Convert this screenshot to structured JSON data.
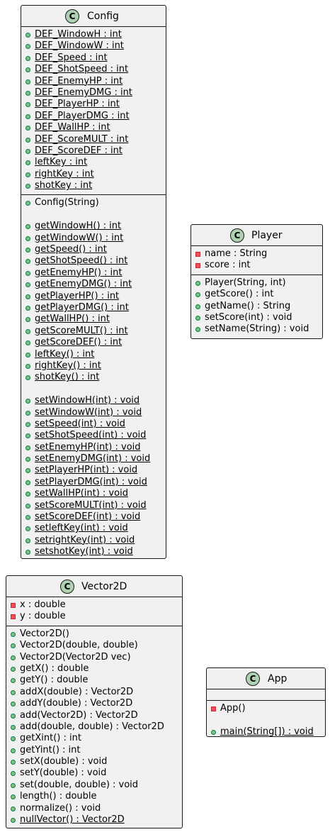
{
  "classes": {
    "config": {
      "name": "Config",
      "attributes": [
        {
          "text": "DEF_WindowH : int",
          "vis": "public",
          "static": true
        },
        {
          "text": "DEF_WindowW : int",
          "vis": "public",
          "static": true
        },
        {
          "text": "DEF_Speed : int",
          "vis": "public",
          "static": true
        },
        {
          "text": "DEF_ShotSpeed : int",
          "vis": "public",
          "static": true
        },
        {
          "text": "DEF_EnemyHP : int",
          "vis": "public",
          "static": true
        },
        {
          "text": "DEF_EnemyDMG : int",
          "vis": "public",
          "static": true
        },
        {
          "text": "DEF_PlayerHP : int",
          "vis": "public",
          "static": true
        },
        {
          "text": "DEF_PlayerDMG : int",
          "vis": "public",
          "static": true
        },
        {
          "text": "DEF_WallHP : int",
          "vis": "public",
          "static": true
        },
        {
          "text": "DEF_ScoreMULT : int",
          "vis": "public",
          "static": true
        },
        {
          "text": "DEF_ScoreDEF : int",
          "vis": "public",
          "static": true
        },
        {
          "text": "leftKey : int",
          "vis": "public",
          "static": true
        },
        {
          "text": "rightKey : int",
          "vis": "public",
          "static": true
        },
        {
          "text": "shotKey : int",
          "vis": "public",
          "static": true
        }
      ],
      "methods": [
        {
          "text": "Config(String)",
          "vis": "public",
          "static": false
        },
        {
          "gap": true
        },
        {
          "text": "getWindowH() : int",
          "vis": "public",
          "static": true
        },
        {
          "text": "getWindowW() : int",
          "vis": "public",
          "static": true
        },
        {
          "text": "getSpeed() : int",
          "vis": "public",
          "static": true
        },
        {
          "text": "getShotSpeed() : int",
          "vis": "public",
          "static": true
        },
        {
          "text": "getEnemyHP() : int",
          "vis": "public",
          "static": true
        },
        {
          "text": "getEnemyDMG() : int",
          "vis": "public",
          "static": true
        },
        {
          "text": "getPlayerHP() : int",
          "vis": "public",
          "static": true
        },
        {
          "text": "getPlayerDMG() : int",
          "vis": "public",
          "static": true
        },
        {
          "text": "getWallHP() : int",
          "vis": "public",
          "static": true
        },
        {
          "text": "getScoreMULT() : int",
          "vis": "public",
          "static": true
        },
        {
          "text": "getScoreDEF() : int",
          "vis": "public",
          "static": true
        },
        {
          "text": "leftKey() : int",
          "vis": "public",
          "static": true
        },
        {
          "text": "rightKey() : int",
          "vis": "public",
          "static": true
        },
        {
          "text": "shotKey() : int",
          "vis": "public",
          "static": true
        },
        {
          "gap": true
        },
        {
          "text": "setWindowH(int) : void",
          "vis": "public",
          "static": true
        },
        {
          "text": "setWindowW(int) : void",
          "vis": "public",
          "static": true
        },
        {
          "text": "setSpeed(int) : void",
          "vis": "public",
          "static": true
        },
        {
          "text": "setShotSpeed(int) : void",
          "vis": "public",
          "static": true
        },
        {
          "text": "setEnemyHP(int) : void",
          "vis": "public",
          "static": true
        },
        {
          "text": "setEnemyDMG(int) : void",
          "vis": "public",
          "static": true
        },
        {
          "text": "setPlayerHP(int) : void",
          "vis": "public",
          "static": true
        },
        {
          "text": "setPlayerDMG(int) : void",
          "vis": "public",
          "static": true
        },
        {
          "text": "setWallHP(int) : void",
          "vis": "public",
          "static": true
        },
        {
          "text": "setScoreMULT(int) : void",
          "vis": "public",
          "static": true
        },
        {
          "text": "setScoreDEF(int) : void",
          "vis": "public",
          "static": true
        },
        {
          "text": "setleftKey(int) : void",
          "vis": "public",
          "static": true
        },
        {
          "text": "setrightKey(int) : void",
          "vis": "public",
          "static": true
        },
        {
          "text": "setshotKey(int) : void",
          "vis": "public",
          "static": true
        }
      ]
    },
    "player": {
      "name": "Player",
      "attributes": [
        {
          "text": "name : String",
          "vis": "private",
          "static": false
        },
        {
          "text": "score : int",
          "vis": "private",
          "static": false
        }
      ],
      "methods": [
        {
          "text": "Player(String, int)",
          "vis": "public",
          "static": false
        },
        {
          "text": "getScore() : int",
          "vis": "public",
          "static": false
        },
        {
          "text": "getName() : String",
          "vis": "public",
          "static": false
        },
        {
          "text": "setScore(int) : void",
          "vis": "public",
          "static": false
        },
        {
          "text": "setName(String) : void",
          "vis": "public",
          "static": false
        }
      ]
    },
    "vector2d": {
      "name": "Vector2D",
      "attributes": [
        {
          "text": "x : double",
          "vis": "private",
          "static": false
        },
        {
          "text": "y : double",
          "vis": "private",
          "static": false
        }
      ],
      "methods": [
        {
          "text": "Vector2D()",
          "vis": "public",
          "static": false
        },
        {
          "text": "Vector2D(double, double)",
          "vis": "public",
          "static": false
        },
        {
          "text": "Vector2D(Vector2D vec)",
          "vis": "public",
          "static": false
        },
        {
          "text": "getX() : double",
          "vis": "public",
          "static": false
        },
        {
          "text": "getY() : double",
          "vis": "public",
          "static": false
        },
        {
          "text": "addX(double) : Vector2D",
          "vis": "public",
          "static": false
        },
        {
          "text": "addY(double) : Vector2D",
          "vis": "public",
          "static": false
        },
        {
          "text": "add(Vector2D) : Vector2D",
          "vis": "public",
          "static": false
        },
        {
          "text": "add(double, double) : Vector2D",
          "vis": "public",
          "static": false
        },
        {
          "text": "getXint() : int",
          "vis": "public",
          "static": false
        },
        {
          "text": "getYint() : int",
          "vis": "public",
          "static": false
        },
        {
          "text": "setX(double) : void",
          "vis": "public",
          "static": false
        },
        {
          "text": "setY(double) : void",
          "vis": "public",
          "static": false
        },
        {
          "text": "set(double, double) : void",
          "vis": "public",
          "static": false
        },
        {
          "text": "length() : double",
          "vis": "public",
          "static": false
        },
        {
          "text": "normalize() : void",
          "vis": "public",
          "static": false
        },
        {
          "text": "nullVector() : Vector2D",
          "vis": "public",
          "static": true
        }
      ]
    },
    "app": {
      "name": "App",
      "attributes": [],
      "methods": [
        {
          "text": "App()",
          "vis": "private",
          "static": false
        },
        {
          "gap": true
        },
        {
          "text": "main(String[]) : void",
          "vis": "public",
          "static": true
        }
      ]
    }
  },
  "badge_letter": "C",
  "colors": {
    "class_bg": "#f1f1f1",
    "badge_bg": "#add1b2",
    "public_fill": "#84be84",
    "private_fill": "#f24d5c",
    "border": "#181818"
  }
}
